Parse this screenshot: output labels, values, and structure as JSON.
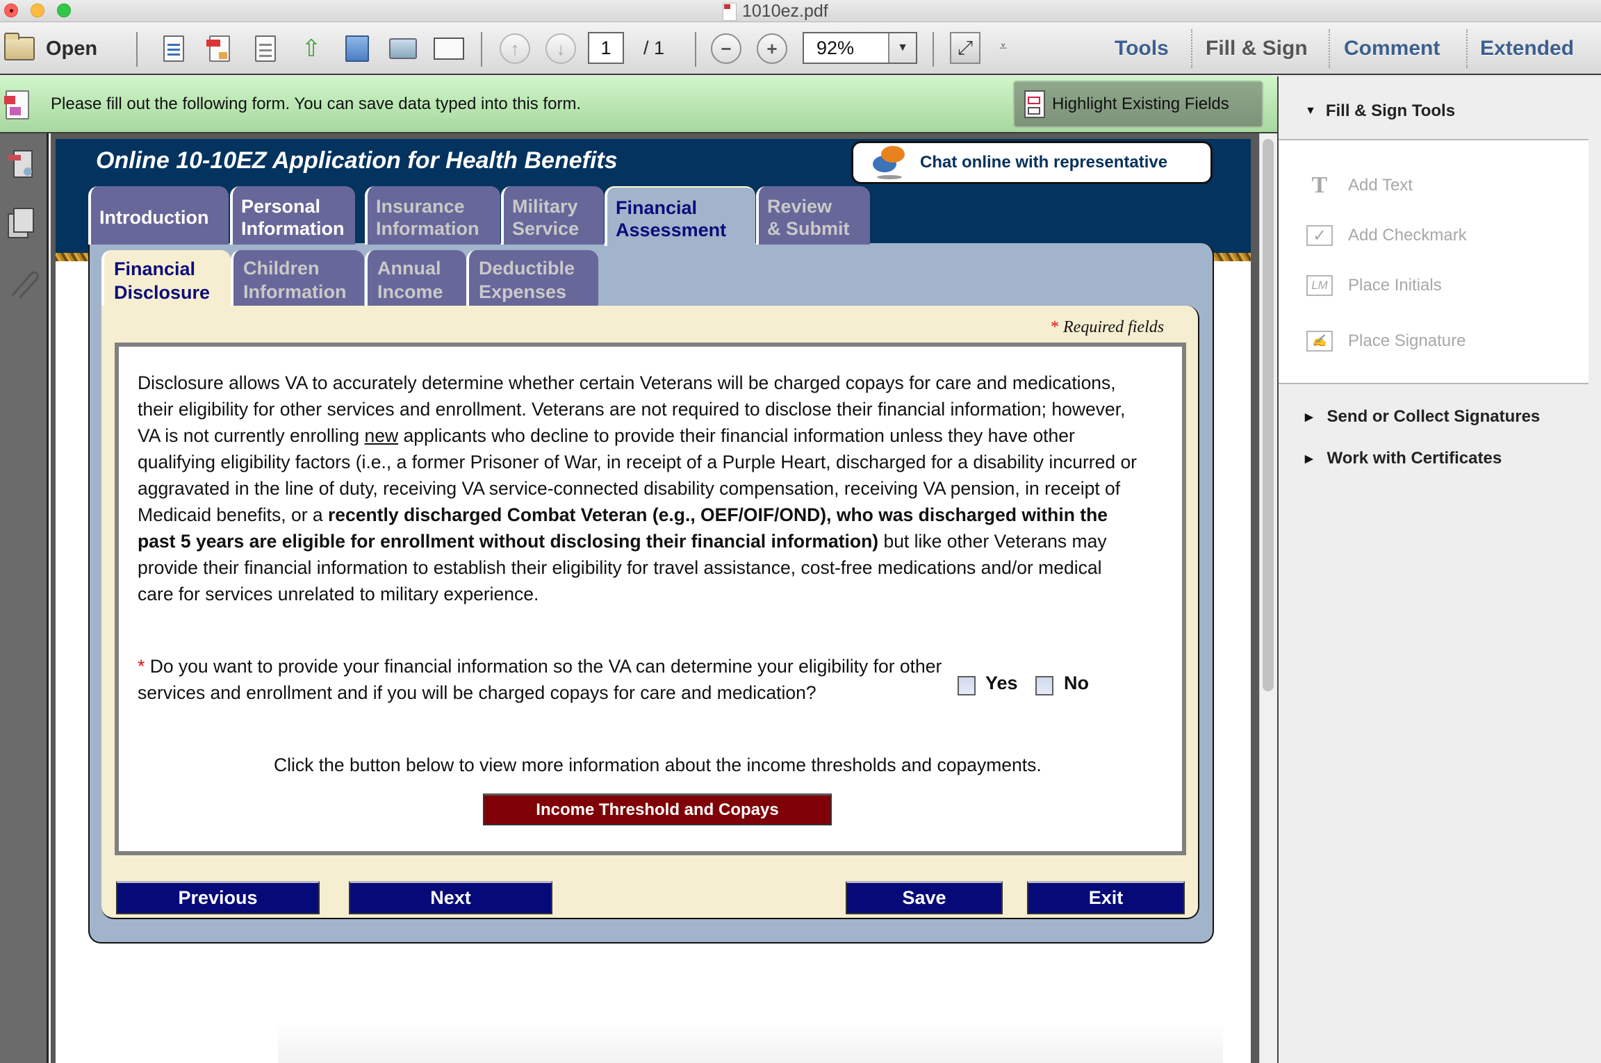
{
  "window": {
    "title": "1010ez.pdf"
  },
  "toolbar": {
    "open_label": "Open",
    "icons": [
      "create-pdf-icon",
      "export-pdf-icon",
      "edit-pdf-icon",
      "upload-cloud-icon",
      "save-icon",
      "print-icon",
      "email-icon"
    ],
    "page_current": "1",
    "page_total": "/ 1",
    "zoom_value": "92%",
    "links": {
      "tools": "Tools",
      "fill_sign": "Fill & Sign",
      "comment": "Comment",
      "extended": "Extended"
    },
    "colors": {
      "link_blue": "#3d5f8f",
      "link_gray": "#555555"
    }
  },
  "infobar": {
    "message": "Please fill out the following form. You can save data typed into this form.",
    "highlight_label": "Highlight Existing Fields"
  },
  "form": {
    "title": "Online 10-10EZ Application for Health Benefits",
    "chat_label": "Chat online with representative",
    "main_tabs": [
      {
        "line1": "Introduction",
        "line2": ""
      },
      {
        "line1": "Personal",
        "line2": "Information"
      },
      {
        "line1": "Insurance",
        "line2": "Information"
      },
      {
        "line1": "Military",
        "line2": "Service"
      },
      {
        "line1": "Financial",
        "line2": "Assessment"
      },
      {
        "line1": "Review",
        "line2": "& Submit"
      }
    ],
    "active_main_tab": "Financial Assessment",
    "sub_tabs": [
      {
        "line1": "Financial",
        "line2": "Disclosure"
      },
      {
        "line1": "Children",
        "line2": "Information"
      },
      {
        "line1": "Annual",
        "line2": "Income"
      },
      {
        "line1": "Deductible",
        "line2": "Expenses"
      }
    ],
    "active_sub_tab": "Financial Disclosure",
    "required_star": "*",
    "required_note": "Required fields",
    "disclosure": {
      "part1": "Disclosure allows VA to accurately determine whether certain Veterans will be charged copays for care and medications, their eligibility for other services and enrollment. Veterans are not required to disclose their financial information; however, VA is not currently enrolling ",
      "underlined": "new",
      "part2": " applicants who decline to provide their financial information unless they have other qualifying eligibility factors (i.e., a former Prisoner of War, in receipt of a Purple Heart, discharged for a disability incurred or aggravated in the line of duty, receiving VA service-connected disability compensation, receiving VA pension, in receipt of Medicaid benefits, or a ",
      "bold": "recently discharged Combat Veteran (e.g., OEF/OIF/OND), who was discharged within the past 5 years are eligible for enrollment without disclosing their financial information)",
      "part3": " but like other Veterans may provide their financial information to establish their eligibility for travel assistance, cost-free medications and/or medical care for services unrelated to military experience."
    },
    "question": {
      "star": "*",
      "text": " Do you want to provide your financial information so the VA can determine your eligibility for other services and enrollment and if you will be charged copays for care and medication?",
      "options": [
        {
          "label": "Yes",
          "checked": false
        },
        {
          "label": "No",
          "checked": false
        }
      ]
    },
    "info_line": "Click the button below to view more information about the income thresholds and copayments.",
    "income_button": "Income Threshold and Copays",
    "buttons": {
      "previous": "Previous",
      "next": "Next",
      "save": "Save",
      "exit": "Exit"
    },
    "colors": {
      "header_bg": "#04335f",
      "tab_inactive": "#67679a",
      "tab_panel": "#a1b4cb",
      "cream": "#f6eed0",
      "nav_button": "#050a78",
      "income_button": "#800007"
    }
  },
  "right_panel": {
    "section_title": "Fill & Sign Tools",
    "tools": [
      {
        "icon": "add-text-icon",
        "label": "Add Text"
      },
      {
        "icon": "checkmark-icon",
        "label": "Add Checkmark"
      },
      {
        "icon": "initials-icon",
        "label": "Place Initials"
      },
      {
        "icon": "signature-icon",
        "label": "Place Signature"
      }
    ],
    "sections": [
      {
        "label": "Send or Collect Signatures"
      },
      {
        "label": "Work with Certificates"
      }
    ]
  }
}
